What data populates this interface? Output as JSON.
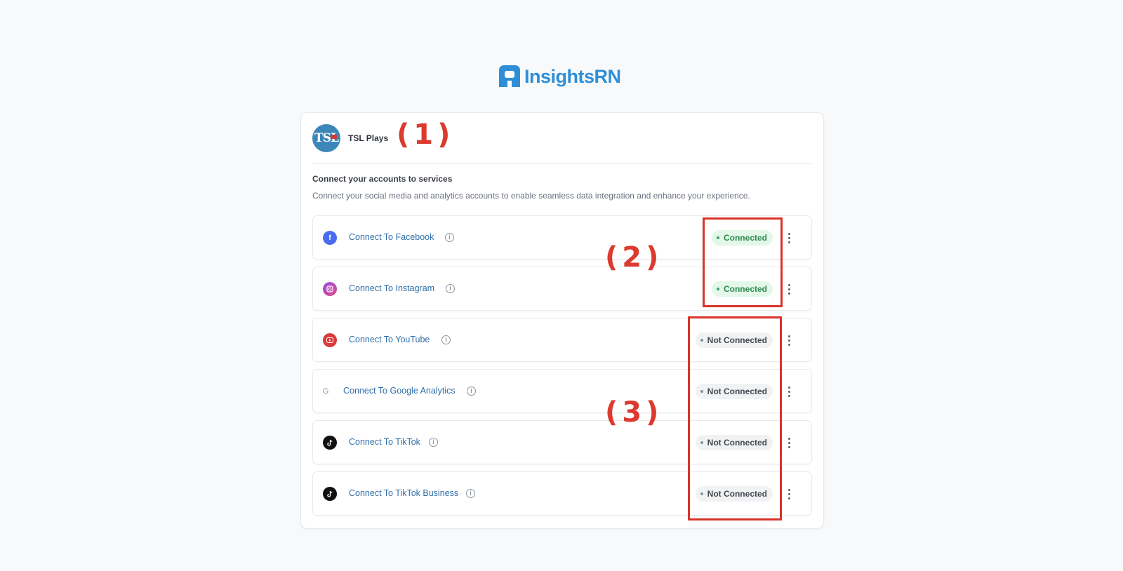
{
  "brand": {
    "name": "InsightsRN",
    "color": "#2f8fd6"
  },
  "profile": {
    "avatar_text": "TSL",
    "name": "TSL Plays"
  },
  "section": {
    "title": "Connect your accounts to services",
    "description": "Connect your social media and analytics accounts to enable seamless data integration and enhance your experience."
  },
  "services": [
    {
      "label": "Connect To Facebook",
      "icon": "facebook-icon",
      "icon_color": "#4a6cf0",
      "status": "Connected"
    },
    {
      "label": "Connect To Instagram",
      "icon": "instagram-icon",
      "icon_color": "#b84fd0",
      "status": "Connected"
    },
    {
      "label": "Connect To YouTube",
      "icon": "youtube-icon",
      "icon_color": "#d83b3b",
      "status": "Not Connected"
    },
    {
      "label": "Connect To Google Analytics",
      "icon": "google-icon",
      "icon_color": "#8a9099",
      "status": "Not Connected"
    },
    {
      "label": "Connect To TikTok",
      "icon": "tiktok-icon",
      "icon_color": "#111111",
      "status": "Not Connected"
    },
    {
      "label": "Connect To TikTok Business",
      "icon": "tiktok-icon",
      "icon_color": "#111111",
      "status": "Not Connected"
    }
  ],
  "annotations": {
    "m1": "(1)",
    "m2": "(2)",
    "m3": "(3)",
    "color": "#d9342a"
  }
}
